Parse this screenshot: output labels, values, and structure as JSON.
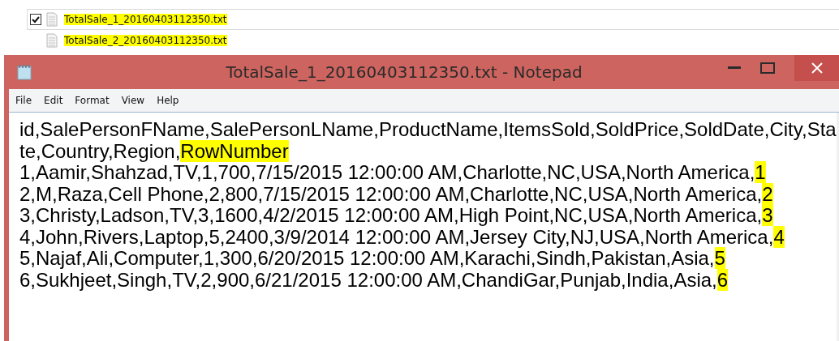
{
  "files": [
    {
      "name": "TotalSale_1_20160403112350.txt",
      "checked": true,
      "selected": true
    },
    {
      "name": "TotalSale_2_20160403112350.txt",
      "checked": false,
      "selected": false
    }
  ],
  "window": {
    "title": "TotalSale_1_20160403112350.txt - Notepad"
  },
  "menu": [
    "File",
    "Edit",
    "Format",
    "View",
    "Help"
  ],
  "lines": [
    {
      "text": "id,SalePersonFName,SalePersonLName,ProductName,ItemsSold,SoldPrice,SoldDate,City,Sta"
    },
    {
      "text": "te,Country,Region,",
      "highlighted": "RowNumber"
    },
    {
      "text": "1,Aamir,Shahzad,TV,1,700,7/15/2015 12:00:00 AM,Charlotte,NC,USA,North America,",
      "highlighted": "1"
    },
    {
      "text": "2,M,Raza,Cell Phone,2,800,7/15/2015 12:00:00 AM,Charlotte,NC,USA,North America,",
      "highlighted": "2"
    },
    {
      "text": "3,Christy,Ladson,TV,3,1600,4/2/2015 12:00:00 AM,High Point,NC,USA,North America,",
      "highlighted": "3"
    },
    {
      "text": "4,John,Rivers,Laptop,5,2400,3/9/2014 12:00:00 AM,Jersey City,NJ,USA,North America,",
      "highlighted": "4"
    },
    {
      "text": "5,Najaf,Ali,Computer,1,300,6/20/2015 12:00:00 AM,Karachi,Sindh,Pakistan,Asia,",
      "highlighted": "5"
    },
    {
      "text": "6,Sukhjeet,Singh,TV,2,900,6/21/2015 12:00:00 AM,ChandiGar,Punjab,India,Asia,",
      "highlighted": "6"
    }
  ]
}
